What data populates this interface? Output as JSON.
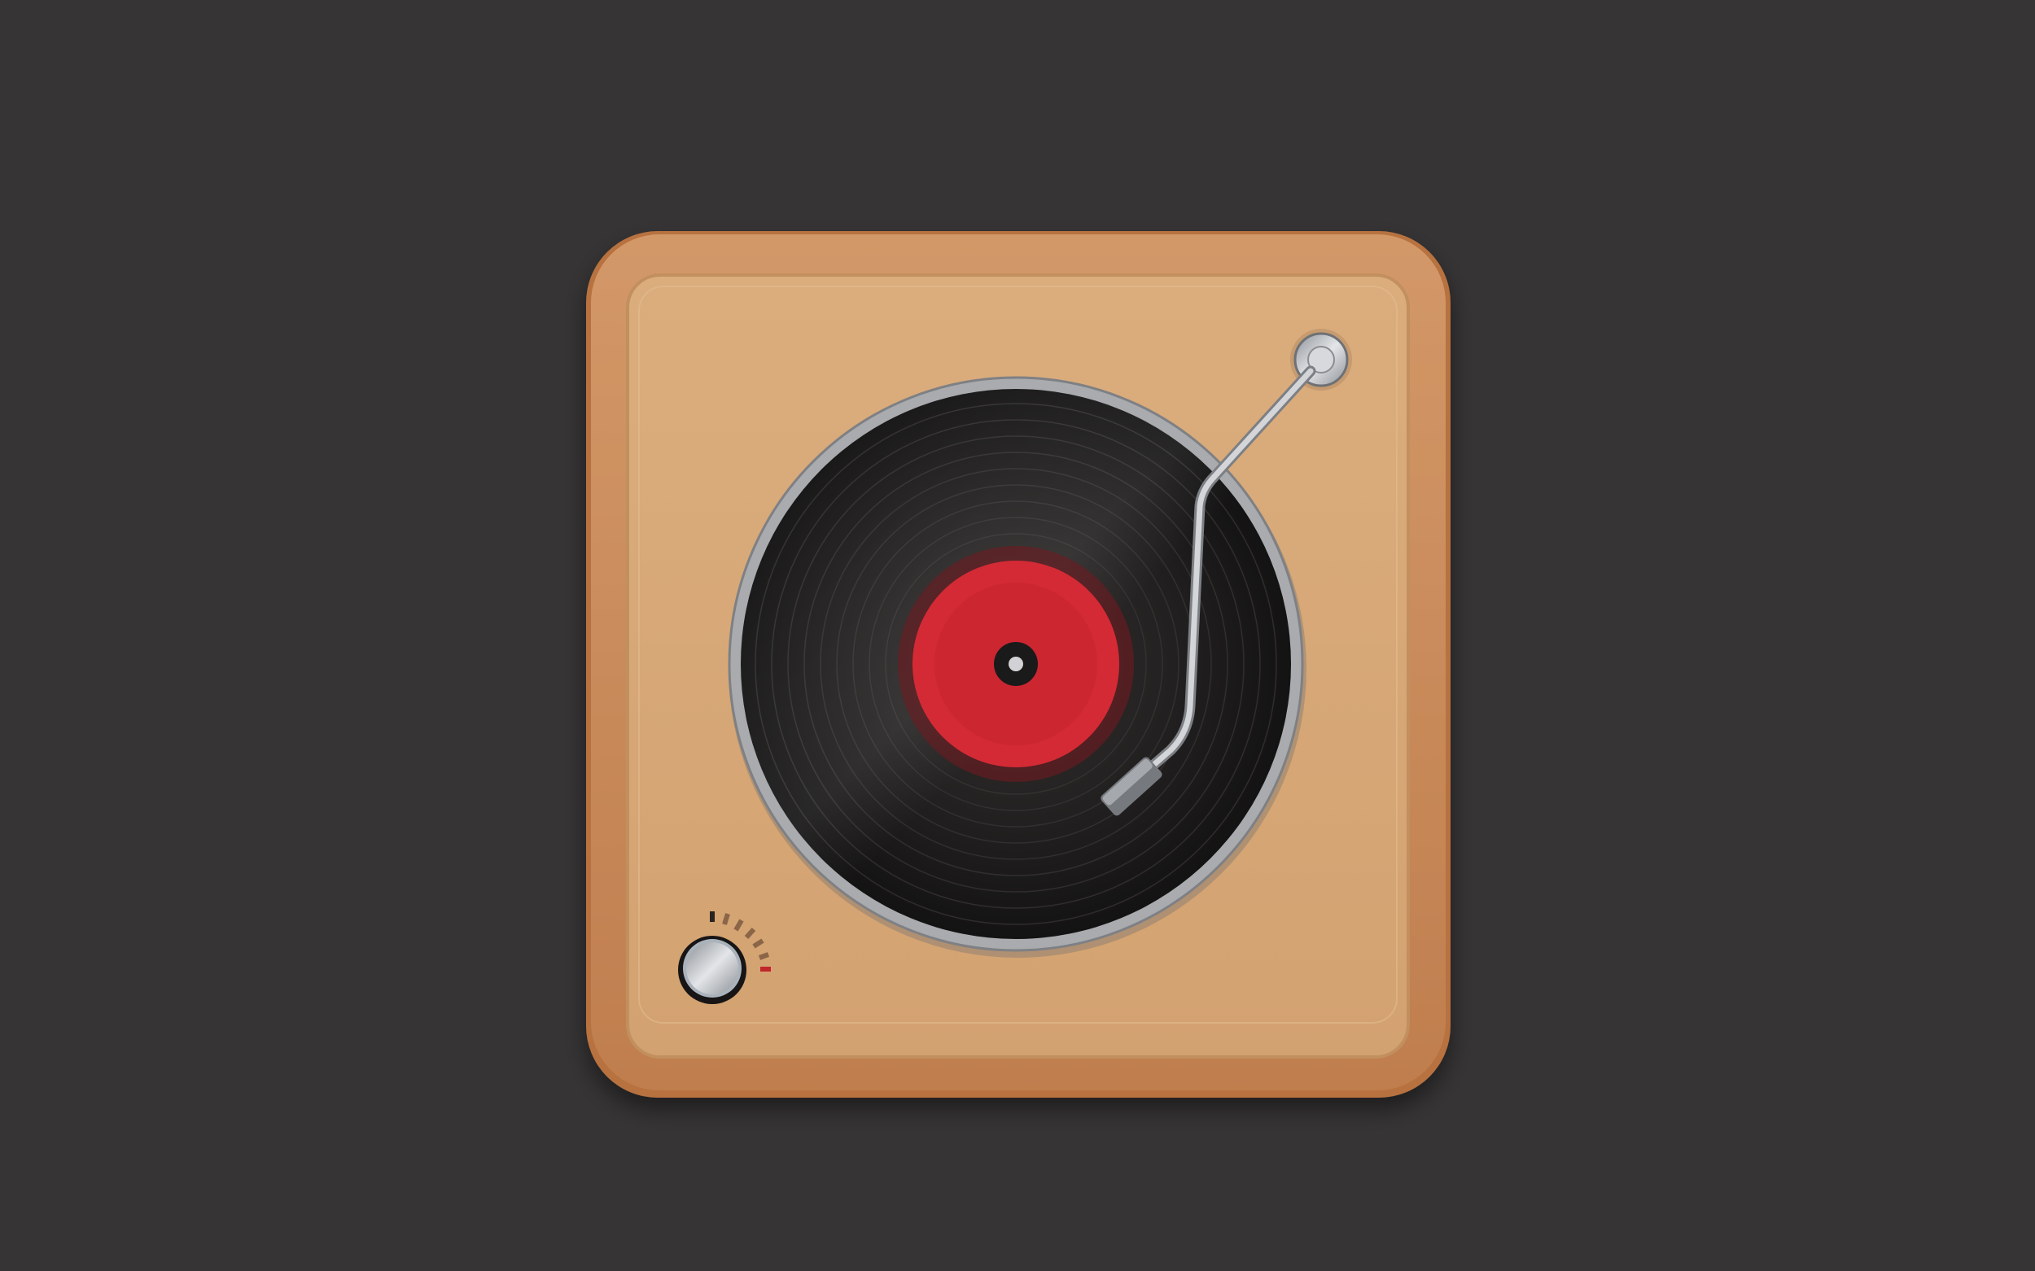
{
  "colors": {
    "background": "#363435",
    "wood_frame": "#c8885a",
    "panel": "#d7a877",
    "vinyl": "#1c1a1a",
    "label": "#d42a35",
    "platter_rim": "#a9abae",
    "metal": "#c4c7cb",
    "tick_active": "#c0262c"
  },
  "icons": {
    "turntable": "turntable-icon",
    "record": "vinyl-record-icon",
    "tonearm": "tonearm-icon",
    "knob": "volume-knob-icon"
  },
  "volume_dial": {
    "tick_count": 7,
    "active_tick_index": 6
  }
}
